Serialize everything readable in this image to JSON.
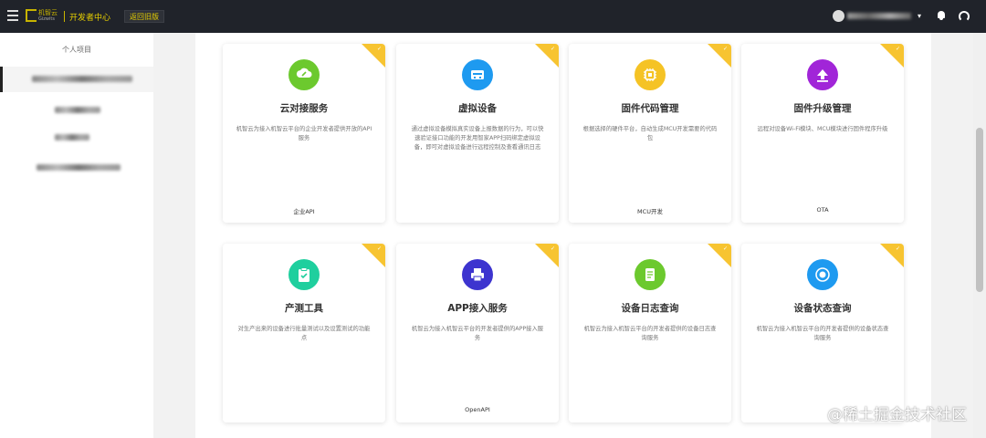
{
  "topbar": {
    "logo_text": "机智云",
    "logo_sub": "Gizwits",
    "dev_center": "开发者中心",
    "return_label": "返回旧版",
    "user_dropdown": "▾"
  },
  "sidebar": {
    "title": "个人项目",
    "items": [
      {
        "active": true
      },
      {
        "active": false
      },
      {
        "active": false
      },
      {
        "active": false
      }
    ]
  },
  "cards": [
    {
      "title": "云对接服务",
      "desc": "机智云为接入机智云平台的企业开发者提供开放的API服务",
      "tag": "企业API",
      "icon": "cloud-link-icon",
      "color": "#6cc92e"
    },
    {
      "title": "虚拟设备",
      "desc": "通过虚拟设备模拟真实设备上报数据的行为，可以快速验证接口功能的开发用智家APP扫码绑定虚拟设备，即可对虚拟设备进行远程控制及查看通讯日志",
      "tag": "",
      "icon": "virtual-device-icon",
      "color": "#1e9af0"
    },
    {
      "title": "固件代码管理",
      "desc": "根据选择的硬件平台，自动生成MCU开发需要的代码包",
      "tag": "MCU开发",
      "icon": "chip-icon",
      "color": "#f5c325"
    },
    {
      "title": "固件升级管理",
      "desc": "远程对设备Wi-Fi模块、MCU模块进行固件程序升级",
      "tag": "OTA",
      "icon": "upload-icon",
      "color": "#a125d8"
    },
    {
      "title": "产测工具",
      "desc": "对生产出来的设备进行批量测试以及设置测试的功能点",
      "tag": "",
      "icon": "clipboard-check-icon",
      "color": "#1fcf9e"
    },
    {
      "title": "APP接入服务",
      "desc": "机智云为接入机智云平台的开发者提供的APP接入服务",
      "tag": "OpenAPI",
      "icon": "printer-icon",
      "color": "#3d34cf"
    },
    {
      "title": "设备日志查询",
      "desc": "机智云为接入机智云平台的开发者提供的设备日志查询服务",
      "tag": "",
      "icon": "log-icon",
      "color": "#6cc92e"
    },
    {
      "title": "设备状态查询",
      "desc": "机智云为接入机智云平台的开发者提供的设备状态查询服务",
      "tag": "",
      "icon": "status-icon",
      "color": "#1e9af0"
    }
  ],
  "watermark": "@稀土掘金技术社区"
}
